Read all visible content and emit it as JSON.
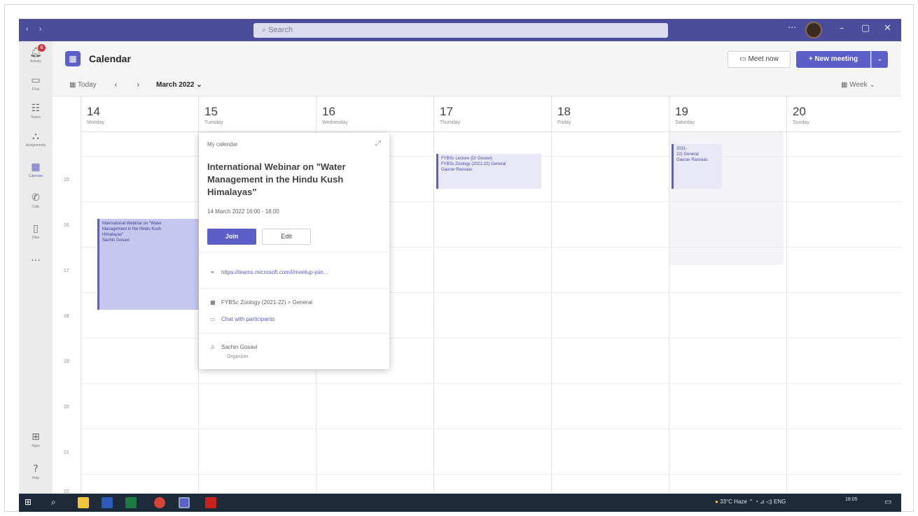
{
  "titlebar": {
    "search_placeholder": "Search"
  },
  "rail": {
    "items": [
      {
        "label": "Activity",
        "icon": "bell-icon",
        "badge": "6"
      },
      {
        "label": "Chat",
        "icon": "chat-icon"
      },
      {
        "label": "Teams",
        "icon": "teams-icon"
      },
      {
        "label": "Assignments",
        "icon": "assignments-icon"
      },
      {
        "label": "Calendar",
        "icon": "calendar-icon"
      },
      {
        "label": "Calls",
        "icon": "phone-icon"
      },
      {
        "label": "Files",
        "icon": "file-icon"
      },
      {
        "label": "...",
        "icon": "more-icon"
      },
      {
        "label": "Apps",
        "icon": "apps-icon"
      },
      {
        "label": "Help",
        "icon": "help-icon"
      }
    ]
  },
  "header": {
    "title": "Calendar",
    "meet_now": "Meet now",
    "new_meeting": "+ New meeting"
  },
  "toolbar": {
    "today": "Today",
    "month": "March 2022",
    "view": "Week"
  },
  "days": [
    {
      "num": "14",
      "name": "Monday"
    },
    {
      "num": "15",
      "name": "Tuesday"
    },
    {
      "num": "16",
      "name": "Wednesday"
    },
    {
      "num": "17",
      "name": "Thursday"
    },
    {
      "num": "18",
      "name": "Friday"
    },
    {
      "num": "19",
      "name": "Saturday"
    },
    {
      "num": "20",
      "name": "Sunday"
    }
  ],
  "hours": [
    "15",
    "16",
    "17",
    "18",
    "19",
    "20",
    "21",
    "22"
  ],
  "events": {
    "webinar": [
      "International Webinar on \"Water",
      "Management in the Hindu Kush",
      "Himalayas\"",
      "Sachin Gosavi"
    ],
    "thursday": [
      "FYBSc Lecture (Dr Gosavi)",
      "FYBSc Zoology (2021-22) General",
      "Gaurav Rasvaas"
    ],
    "saturday": [
      "2021-",
      "22) General",
      "Gaurav Rasvaas"
    ]
  },
  "popup": {
    "calendar": "My calendar",
    "title": "International Webinar on \"Water Management in the Hindu Kush Himalayas\"",
    "time": "14 March 2022 16:00 - 18:00",
    "join": "Join",
    "edit": "Edit",
    "link": "https://teams.microsoft.com/l/meetup-join...",
    "channel": "FYBSc Zoology (2021-22) > General",
    "chat": "Chat with participants",
    "organizer": "Sachin Gosavi",
    "role": "Organizer"
  },
  "taskbar": {
    "weather": "33°C Haze",
    "lang": "ENG",
    "time": "18:05"
  }
}
